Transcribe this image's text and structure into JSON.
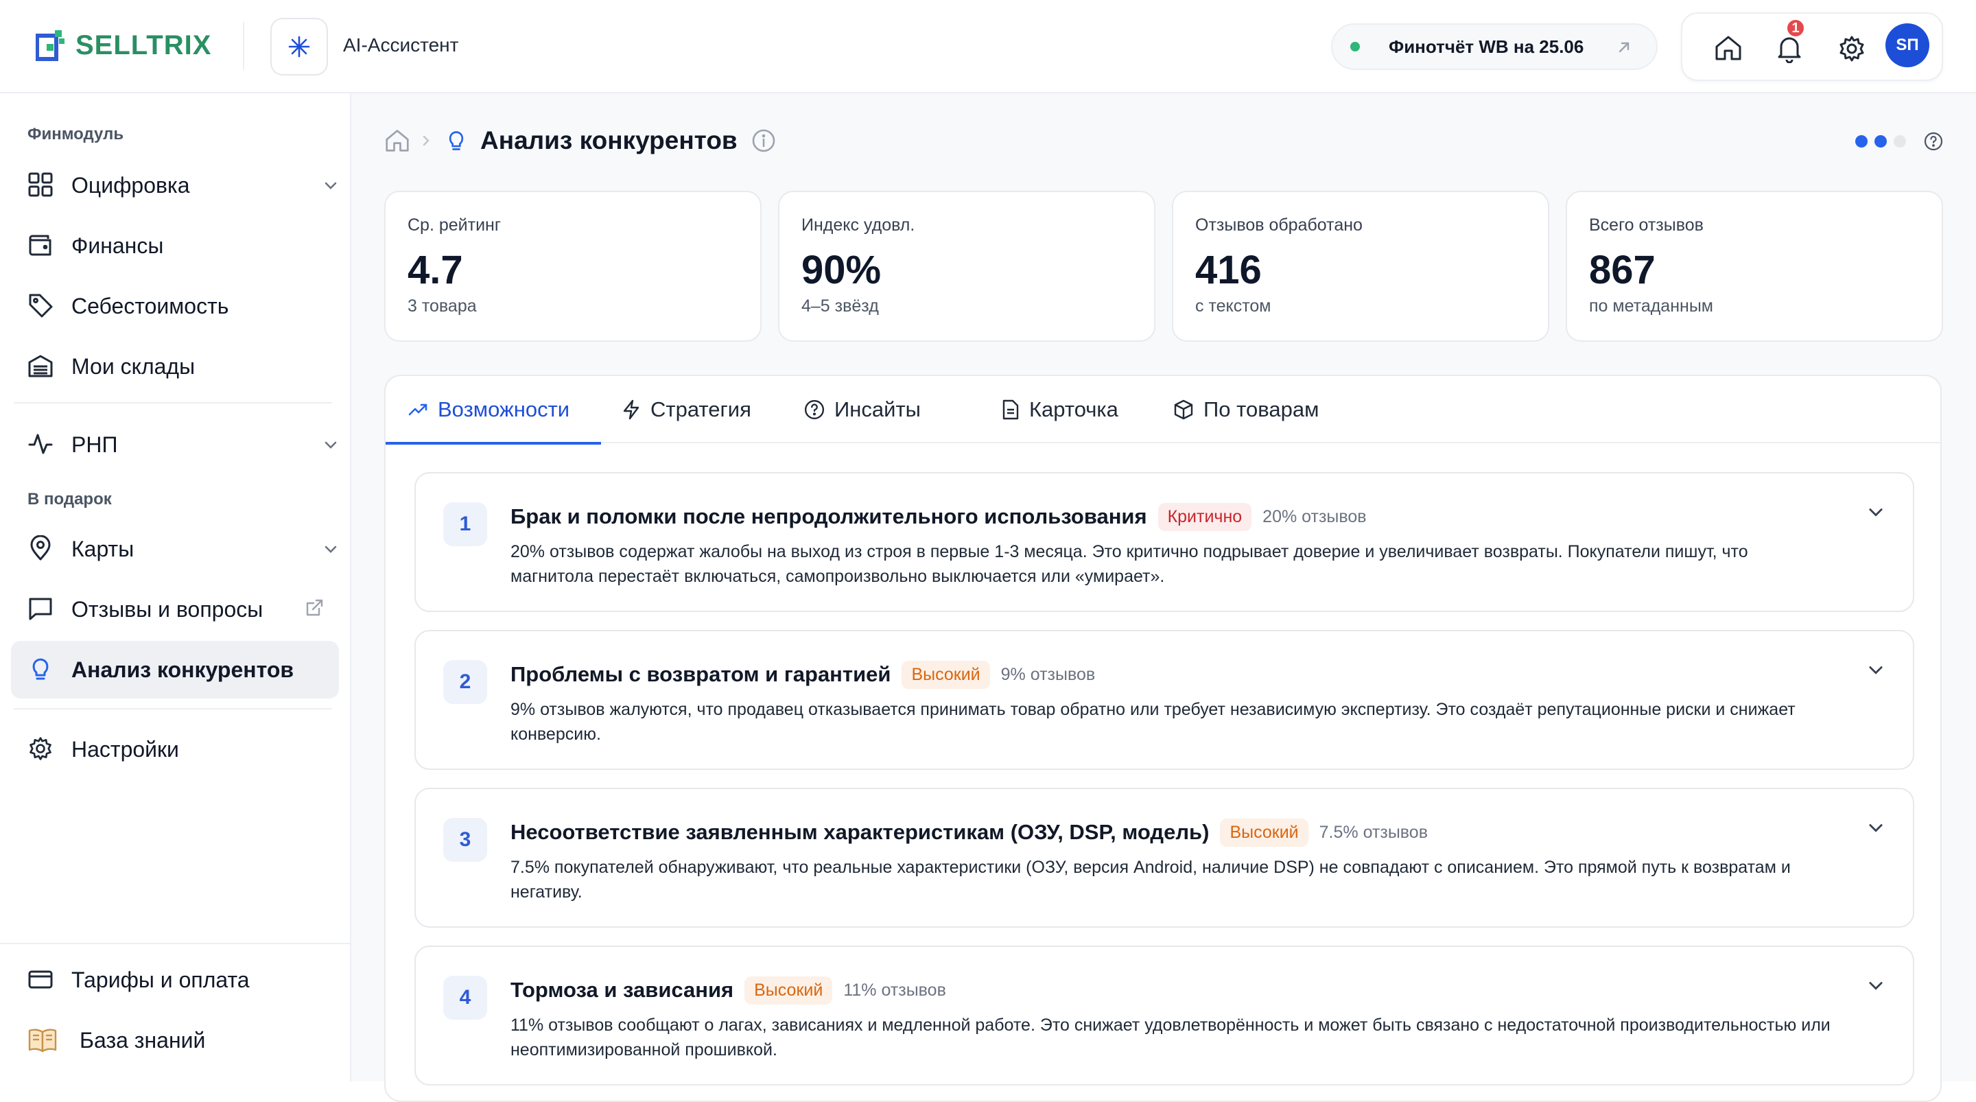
{
  "app": {
    "logo_text": "SELLTRIX",
    "ai_label": "AI-Ассистент",
    "report_label": "Финотчёт WB на 25.06",
    "notifications_count": "1",
    "avatar_initials": "SП",
    "colors": {
      "accent": "#2563eb",
      "brand_green": "#2a8f63",
      "critical": "#c8252c",
      "high": "#d9660f"
    }
  },
  "sidebar": {
    "section1": "Финмодуль",
    "section2": "В подарок",
    "items": [
      {
        "label": "Оцифровка",
        "icon": "grid-icon"
      },
      {
        "label": "Финансы",
        "icon": "wallet-icon"
      },
      {
        "label": "Себестоимость",
        "icon": "tag-icon"
      },
      {
        "label": "Мои склады",
        "icon": "warehouse-icon"
      },
      {
        "label": "РНП",
        "icon": "activity-icon"
      },
      {
        "label": "Карты",
        "icon": "map-pin-icon"
      },
      {
        "label": "Отзывы и вопросы",
        "icon": "message-square-icon"
      },
      {
        "label": "Анализ конкурентов",
        "icon": "lightbulb-icon"
      },
      {
        "label": "Настройки",
        "icon": "gear-icon"
      }
    ],
    "bottom": [
      {
        "label": "Тарифы и оплата",
        "icon": "credit-card-icon"
      },
      {
        "label": "База знаний",
        "icon": "book-icon"
      }
    ]
  },
  "page": {
    "title": "Анализ конкурентов",
    "pager": {
      "total": 3,
      "active": 2
    }
  },
  "stats": [
    {
      "label": "Ср. рейтинг",
      "value": "4.7",
      "sub": "3 товара"
    },
    {
      "label": "Индекс удовл.",
      "value": "90%",
      "sub": "4–5 звёзд"
    },
    {
      "label": "Отзывов обработано",
      "value": "416",
      "sub": "с текстом"
    },
    {
      "label": "Всего отзывов",
      "value": "867",
      "sub": "по метаданным"
    }
  ],
  "tabs": [
    {
      "label": "Возможности",
      "icon": "trending-up-icon",
      "active": true
    },
    {
      "label": "Стратегия",
      "icon": "zap-icon",
      "active": false
    },
    {
      "label": "Инсайты",
      "icon": "help-circle-icon",
      "active": false
    },
    {
      "label": "Карточка",
      "icon": "file-text-icon",
      "active": false
    },
    {
      "label": "По товарам",
      "icon": "package-icon",
      "active": false
    }
  ],
  "items": [
    {
      "num": "1",
      "title": "Брак и поломки после непродолжительного использования",
      "severity": "Критично",
      "share": "20% отзывов",
      "desc": "20% отзывов содержат жалобы на выход из строя в первые 1-3 месяца. Это критично подрывает доверие и увеличивает возвраты. Покупатели пишут, что магнитола перестаёт включаться, самопроизвольно выключается или «умирает»."
    },
    {
      "num": "2",
      "title": "Проблемы с возвратом и гарантией",
      "severity": "Высокий",
      "share": "9% отзывов",
      "desc": "9% отзывов жалуются, что продавец отказывается принимать товар обратно или требует независимую экспертизу. Это создаёт репутационные риски и снижает конверсию."
    },
    {
      "num": "3",
      "title": "Несоответствие заявленным характеристикам (ОЗУ, DSP, модель)",
      "severity": "Высокий",
      "share": "7.5% отзывов",
      "desc": "7.5% покупателей обнаруживают, что реальные характеристики (ОЗУ, версия Android, наличие DSP) не совпадают с описанием. Это прямой путь к возвратам и негативу."
    },
    {
      "num": "4",
      "title": "Тормоза и зависания",
      "severity": "Высокий",
      "share": "11% отзывов",
      "desc": "11% отзывов сообщают о лагах, зависаниях и медленной работе. Это снижает удовлетворённость и может быть связано с недостаточной производительностью или неоптимизированной прошивкой."
    }
  ]
}
